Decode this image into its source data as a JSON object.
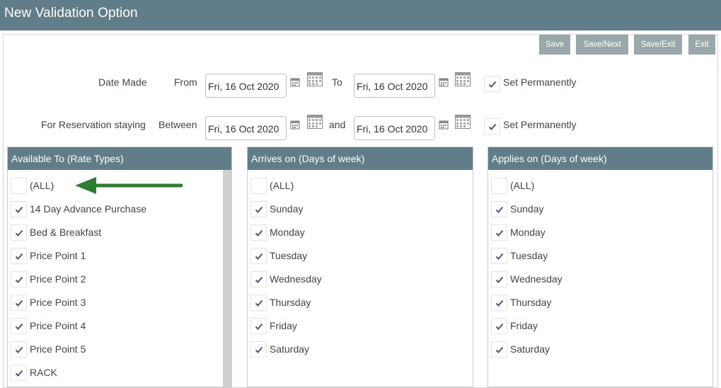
{
  "window": {
    "title": "New Validation Option"
  },
  "toolbar": {
    "save": "Save",
    "save_next": "Save/Next",
    "save_exit": "Save/Exit",
    "exit": "Exit"
  },
  "date_made": {
    "label": "Date Made",
    "from_label": "From",
    "from_value": "Fri, 16 Oct 2020",
    "to_label": "To",
    "to_value": "Fri, 16 Oct 2020",
    "set_permanently": "Set Permanently",
    "set_permanently_checked": true
  },
  "staying": {
    "label": "For Reservation staying",
    "between_label": "Between",
    "between_value": "Fri, 16 Oct 2020",
    "and_label": "and",
    "and_value": "Fri, 16 Oct 2020",
    "set_permanently": "Set Permanently",
    "set_permanently_checked": true
  },
  "rate_types": {
    "header": "Available To (Rate Types)",
    "items": [
      {
        "label": "(ALL)",
        "checked": false
      },
      {
        "label": "14 Day Advance Purchase",
        "checked": true
      },
      {
        "label": "Bed & Breakfast",
        "checked": true
      },
      {
        "label": "Price Point 1",
        "checked": true
      },
      {
        "label": "Price Point 2",
        "checked": true
      },
      {
        "label": "Price Point 3",
        "checked": true
      },
      {
        "label": "Price Point 4",
        "checked": true
      },
      {
        "label": "Price Point 5",
        "checked": true
      },
      {
        "label": "RACK",
        "checked": true
      }
    ]
  },
  "arrives": {
    "header": "Arrives on (Days of week)",
    "items": [
      {
        "label": "(ALL)",
        "checked": false
      },
      {
        "label": "Sunday",
        "checked": true
      },
      {
        "label": "Monday",
        "checked": true
      },
      {
        "label": "Tuesday",
        "checked": true
      },
      {
        "label": "Wednesday",
        "checked": true
      },
      {
        "label": "Thursday",
        "checked": true
      },
      {
        "label": "Friday",
        "checked": true
      },
      {
        "label": "Saturday",
        "checked": true
      }
    ]
  },
  "applies": {
    "header": "Applies on (Days of week)",
    "items": [
      {
        "label": "(ALL)",
        "checked": false
      },
      {
        "label": "Sunday",
        "checked": true
      },
      {
        "label": "Monday",
        "checked": true
      },
      {
        "label": "Tuesday",
        "checked": true
      },
      {
        "label": "Wednesday",
        "checked": true
      },
      {
        "label": "Thursday",
        "checked": true
      },
      {
        "label": "Friday",
        "checked": true
      },
      {
        "label": "Saturday",
        "checked": true
      }
    ]
  },
  "colors": {
    "header_bg": "#617d8a",
    "button_bg": "#9ba8ab",
    "arrow": "#2e7d32",
    "check": "#4a5a75"
  },
  "icons": {
    "check": "checkmark-icon",
    "calendar": "calendar-icon",
    "arrow": "arrow-left-icon"
  }
}
